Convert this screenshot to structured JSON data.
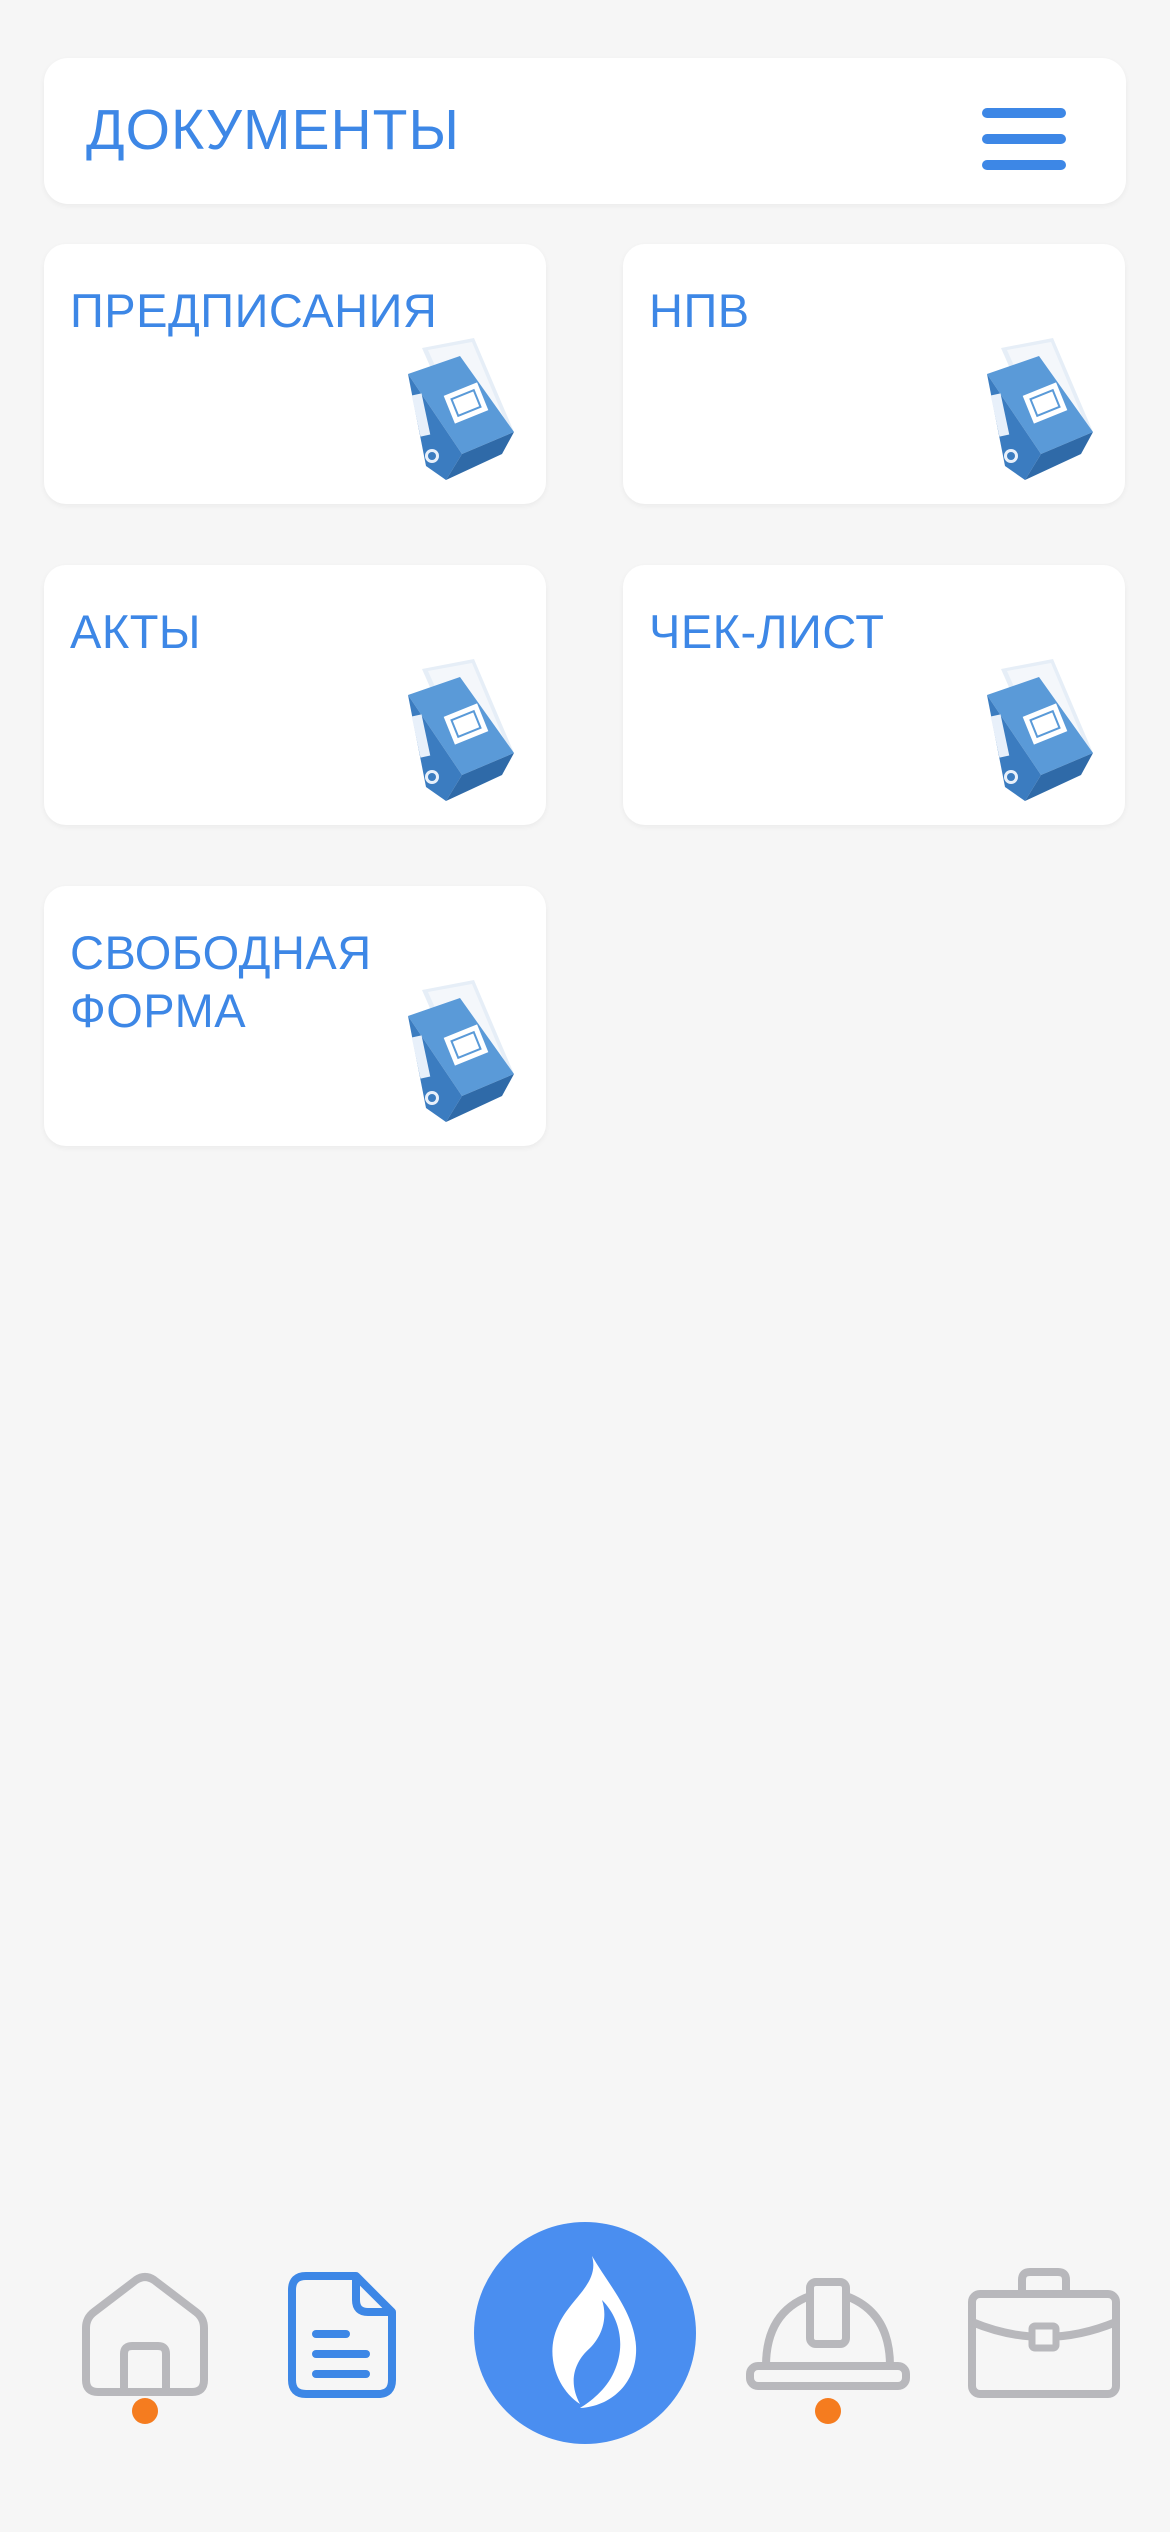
{
  "header": {
    "title": "ДОКУМЕНТЫ",
    "menu_icon": "hamburger-menu-icon"
  },
  "cards": [
    {
      "label": "ПРЕДПИСАНИЯ",
      "icon": "binder-folder-icon"
    },
    {
      "label": "НПВ",
      "icon": "binder-folder-icon"
    },
    {
      "label": "АКТЫ",
      "icon": "binder-folder-icon"
    },
    {
      "label": "ЧЕК-ЛИСТ",
      "icon": "binder-folder-icon"
    },
    {
      "label": "СВОБОДНАЯ\nФОРМА",
      "icon": "binder-folder-icon"
    }
  ],
  "bottom_nav": {
    "items": [
      {
        "icon": "home-icon",
        "active": false,
        "has_notification": true
      },
      {
        "icon": "document-icon",
        "active": true,
        "has_notification": false
      },
      {
        "icon": "flame-icon",
        "active": false,
        "has_notification": false
      },
      {
        "icon": "hard-hat-icon",
        "active": false,
        "has_notification": true
      },
      {
        "icon": "briefcase-icon",
        "active": false,
        "has_notification": false
      }
    ]
  },
  "colors": {
    "accent": "#3d87e6",
    "background": "#f6f6f6",
    "card": "#ffffff",
    "inactive_icon": "#b8b8bc",
    "notification_dot": "#f57c1f",
    "center_button": "#4a8ef0"
  }
}
